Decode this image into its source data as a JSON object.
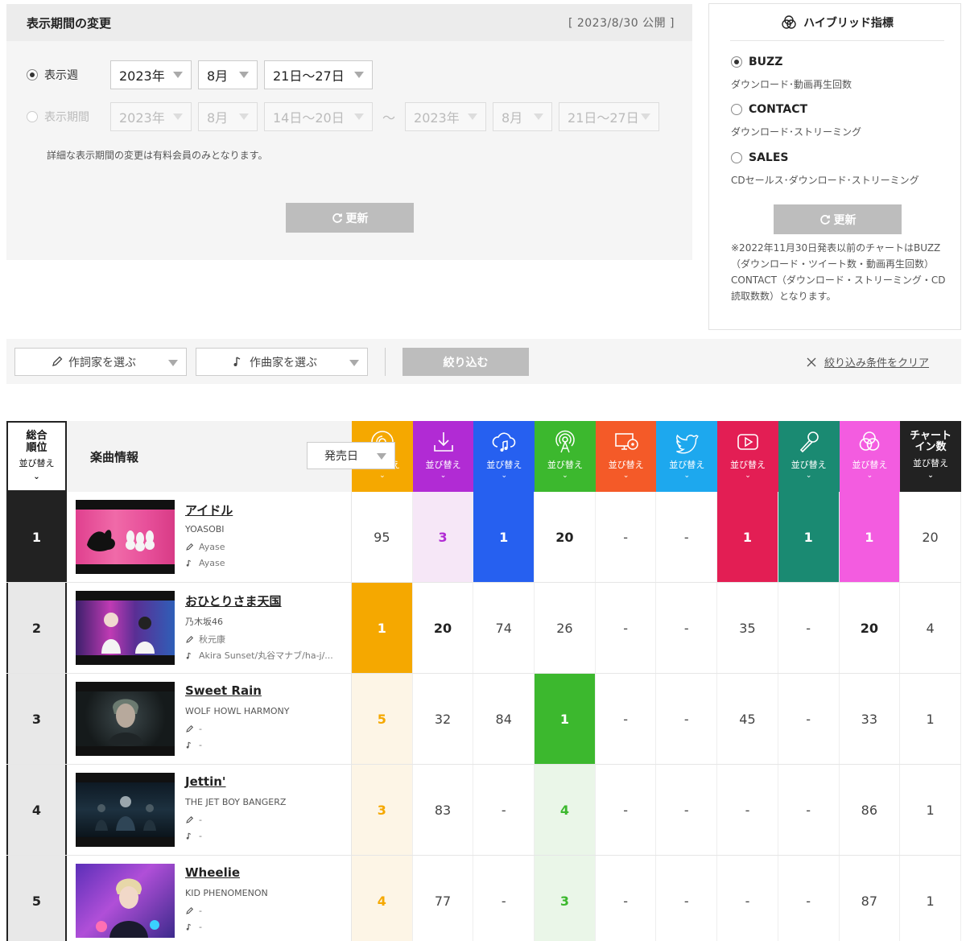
{
  "period": {
    "title": "表示期間の変更",
    "published": "[ 2023/8/30 公開 ]",
    "week_label": "表示週",
    "week_year": "2023年",
    "week_month": "8月",
    "week_days": "21日～27日",
    "range_label": "表示期間",
    "from_year": "2023年",
    "from_month": "8月",
    "from_days": "14日～20日",
    "tilde": "～",
    "to_year": "2023年",
    "to_month": "8月",
    "to_days": "21日～27日",
    "note": "詳細な表示期間の変更は有料会員のみとなります。",
    "update_label": "更新"
  },
  "hybrid": {
    "title": "ハイブリッド指標",
    "options": [
      {
        "label": "BUZZ",
        "desc": "ダウンロード･動画再生回数",
        "selected": true
      },
      {
        "label": "CONTACT",
        "desc": "ダウンロード･ストリーミング",
        "selected": false
      },
      {
        "label": "SALES",
        "desc": "CDセールス･ダウンロード･ストリーミング",
        "selected": false
      }
    ],
    "update_label": "更新",
    "note": "※2022年11月30日発表以前のチャートはBUZZ（ダウンロード・ツイート数・動画再生回数）CONTACT（ダウンロード・ストリーミング・CD読取数数）となります。"
  },
  "filter": {
    "lyricist_placeholder": "作詞家を選ぶ",
    "composer_placeholder": "作曲家を選ぶ",
    "narrow_label": "絞り込む",
    "clear_label": "絞り込み条件をクリア"
  },
  "table": {
    "rank_header_line1": "総合",
    "rank_header_line2": "順位",
    "rank_sort": "並び替え",
    "info_header": "楽曲情報",
    "info_sort_value": "発売日",
    "sort_label": "並び替え",
    "chart_in_line1": "チャート",
    "chart_in_line2": "イン数",
    "columns": [
      {
        "icon": "cd-icon",
        "color": "#f5a800"
      },
      {
        "icon": "download-icon",
        "color": "#b12bd4"
      },
      {
        "icon": "streaming-icon",
        "color": "#2660f0"
      },
      {
        "icon": "radio-icon",
        "color": "#3cb82e"
      },
      {
        "icon": "karaoke-pc-icon",
        "color": "#f45a28"
      },
      {
        "icon": "twitter-icon",
        "color": "#1da8ee"
      },
      {
        "icon": "youtube-icon",
        "color": "#e31e54"
      },
      {
        "icon": "microphone-icon",
        "color": "#1a8a72"
      },
      {
        "icon": "hybrid-icon",
        "color": "#f35ce0"
      },
      {
        "icon": "chart-in-icon",
        "color": "#222222"
      }
    ],
    "rows": [
      {
        "rank": "1",
        "title": "アイドル",
        "artist": "YOASOBI",
        "lyricist": "Ayase",
        "composer": "Ayase",
        "values": [
          "95",
          "3",
          "1",
          "20",
          "-",
          "-",
          "1",
          "1",
          "1",
          "20"
        ],
        "bg": [
          "",
          "#f6e7f7",
          "#2660f0",
          "",
          "",
          "",
          "#e31e54",
          "#1a8a72",
          "#f35ce0",
          ""
        ],
        "fg": [
          "#444",
          "#b12bd4",
          "#fff",
          "#222",
          "#444",
          "#444",
          "#fff",
          "#fff",
          "#fff",
          "#444"
        ]
      },
      {
        "rank": "2",
        "title": "おひとりさま天国",
        "artist": "乃木坂46",
        "lyricist": "秋元康",
        "composer": "Akira Sunset/丸谷マナブ/ha-j/...",
        "values": [
          "1",
          "20",
          "74",
          "26",
          "-",
          "-",
          "35",
          "-",
          "20",
          "4"
        ],
        "bg": [
          "#f5a800",
          "",
          "",
          "",
          "",
          "",
          "",
          "",
          "",
          ""
        ],
        "fg": [
          "#fff",
          "#222",
          "#444",
          "#444",
          "#444",
          "#444",
          "#444",
          "#444",
          "#222",
          "#444"
        ]
      },
      {
        "rank": "3",
        "title": "Sweet Rain",
        "artist": "WOLF HOWL HARMONY",
        "lyricist": "-",
        "composer": "-",
        "values": [
          "5",
          "32",
          "84",
          "1",
          "-",
          "-",
          "45",
          "-",
          "33",
          "1"
        ],
        "bg": [
          "#fdf5e6",
          "",
          "",
          "#3cb82e",
          "",
          "",
          "",
          "",
          "",
          ""
        ],
        "fg": [
          "#f5a800",
          "#444",
          "#444",
          "#fff",
          "#444",
          "#444",
          "#444",
          "#444",
          "#444",
          "#444"
        ]
      },
      {
        "rank": "4",
        "title": "Jettin'",
        "artist": "THE JET BOY BANGERZ",
        "lyricist": "-",
        "composer": "-",
        "values": [
          "3",
          "83",
          "-",
          "4",
          "-",
          "-",
          "-",
          "-",
          "86",
          "1"
        ],
        "bg": [
          "#fdf5e6",
          "",
          "",
          "#eaf6e8",
          "",
          "",
          "",
          "",
          "",
          ""
        ],
        "fg": [
          "#f5a800",
          "#444",
          "#444",
          "#3cb82e",
          "#444",
          "#444",
          "#444",
          "#444",
          "#444",
          "#444"
        ]
      },
      {
        "rank": "5",
        "title": "Wheelie",
        "artist": "KID PHENOMENON",
        "lyricist": "-",
        "composer": "-",
        "values": [
          "4",
          "77",
          "-",
          "3",
          "-",
          "-",
          "-",
          "-",
          "87",
          "1"
        ],
        "bg": [
          "#fdf5e6",
          "",
          "",
          "#eaf6e8",
          "",
          "",
          "",
          "",
          "",
          ""
        ],
        "fg": [
          "#f5a800",
          "#444",
          "#444",
          "#3cb82e",
          "#444",
          "#444",
          "#444",
          "#444",
          "#444",
          "#444"
        ]
      }
    ]
  }
}
